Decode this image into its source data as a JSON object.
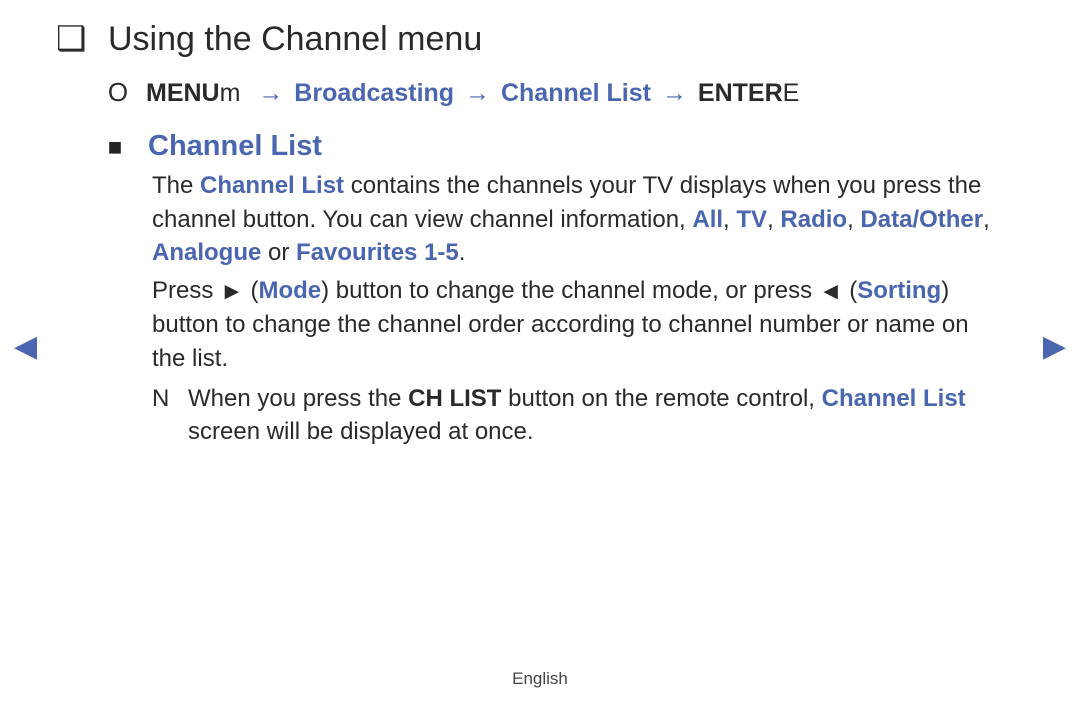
{
  "title": {
    "marker": "❑",
    "text": "Using the Channel menu"
  },
  "nav": {
    "marker": "O",
    "menu_label": "MENU",
    "menu_suffix": "m",
    "arrow": "→",
    "bc": "Broadcasting",
    "cl": "Channel List",
    "enter_label": "ENTER",
    "enter_suffix": "E"
  },
  "section": {
    "marker": "■",
    "title": "Channel List"
  },
  "para1": {
    "t1": "The ",
    "cl": "Channel List",
    "t2": " contains the channels your TV displays when you press the channel button. You can view channel information, ",
    "all": "All",
    "sep": ", ",
    "tv": "TV",
    "radio": "Radio",
    "dataother": "Data/Other",
    "analogue": "Analogue",
    "or": " or ",
    "fav": "Favourites 1-5",
    "dot": "."
  },
  "para2": {
    "t1": "Press ",
    "tri_r": "►",
    "sp": " (",
    "mode": "Mode",
    "t2": ") button to change the channel mode, or press ",
    "tri_l": "◄",
    "sorting": "Sorting",
    "t3": ") button to change the channel order according to channel number or name on the list."
  },
  "note": {
    "marker": "N",
    "t1": "When you press the ",
    "chlist": "CH LIST",
    "t2": " button on the remote control, ",
    "cl": "Channel List",
    "t3": " screen will be displayed at once."
  },
  "footer": {
    "lang": "English"
  },
  "arrows": {
    "left": "◀",
    "right": "▶"
  }
}
